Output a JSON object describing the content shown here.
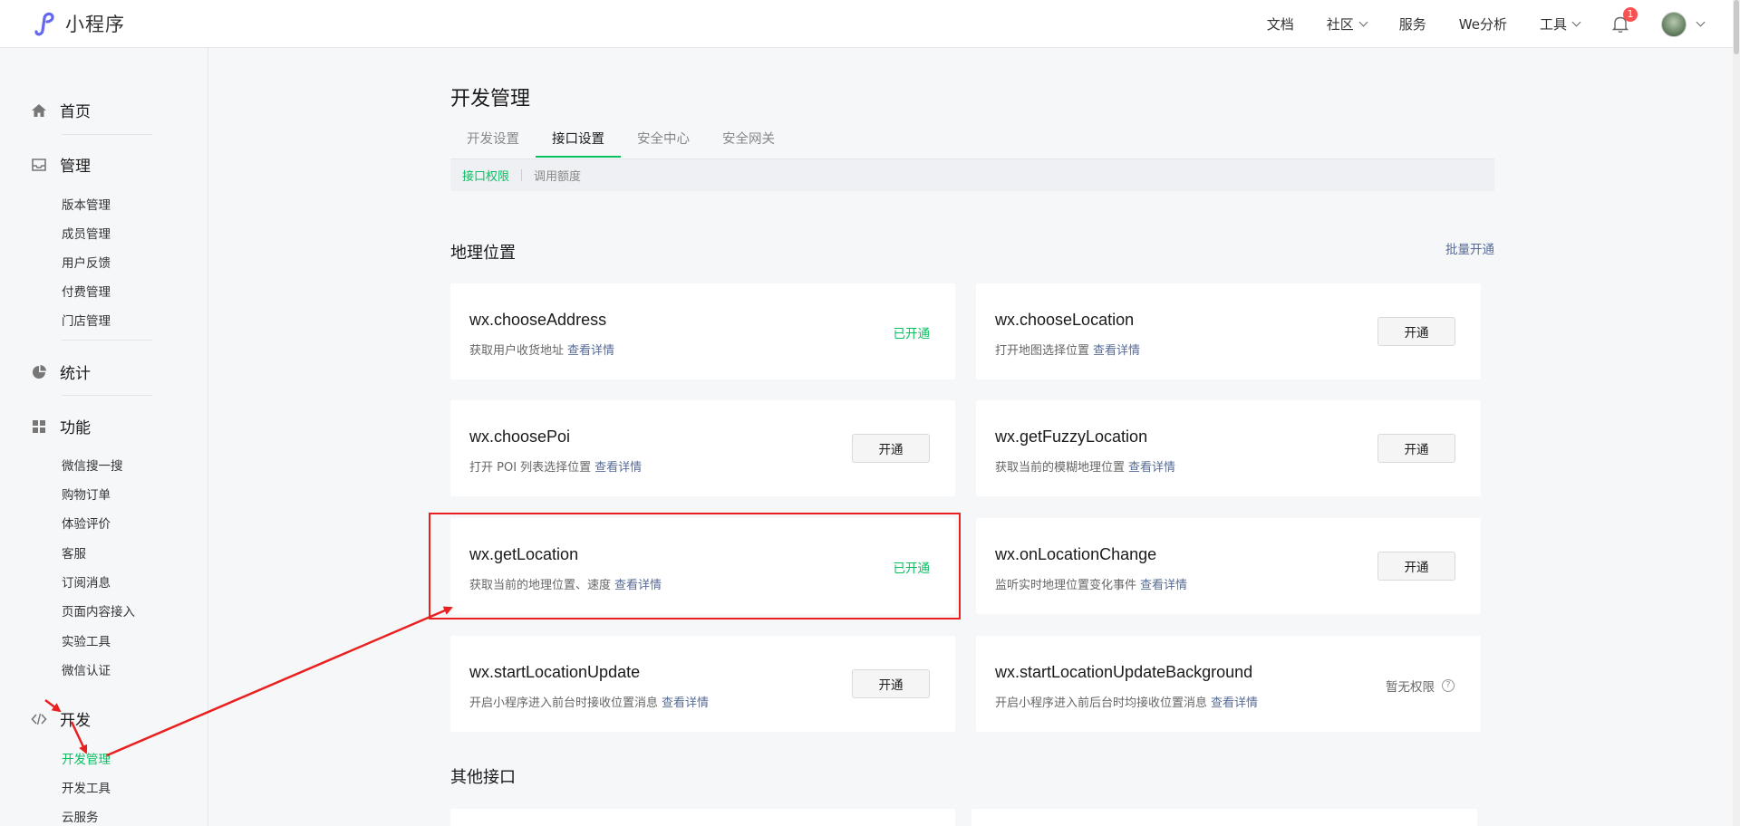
{
  "app": {
    "name": "小程序"
  },
  "topnav": {
    "items": [
      {
        "label": "文档",
        "has_caret": false
      },
      {
        "label": "社区",
        "has_caret": true
      },
      {
        "label": "服务",
        "has_caret": false
      },
      {
        "label": "We分析",
        "has_caret": false
      },
      {
        "label": "工具",
        "has_caret": true
      }
    ],
    "notification_count": "1"
  },
  "sidebar": {
    "home": "首页",
    "manage": {
      "label": "管理",
      "items": [
        "版本管理",
        "成员管理",
        "用户反馈",
        "付费管理",
        "门店管理"
      ]
    },
    "stats": "统计",
    "features": {
      "label": "功能",
      "items": [
        "微信搜一搜",
        "购物订单",
        "体验评价",
        "客服",
        "订阅消息",
        "页面内容接入",
        "实验工具",
        "微信认证"
      ]
    },
    "dev": {
      "label": "开发",
      "items": [
        "开发管理",
        "开发工具",
        "云服务"
      ],
      "active": "开发管理"
    }
  },
  "main": {
    "title": "开发管理",
    "tabs": [
      "开发设置",
      "接口设置",
      "安全中心",
      "安全网关"
    ],
    "active_tab": "接口设置",
    "subtabs": [
      "接口权限",
      "调用额度"
    ],
    "active_subtab": "接口权限",
    "sections": {
      "geo_title": "地理位置",
      "batch_open": "批量开通",
      "other_title": "其他接口"
    },
    "more_label": "查看详情",
    "status_on": "已开通",
    "open_btn": "开通",
    "no_perm": "暂无权限",
    "cards": [
      {
        "name": "wx.chooseAddress",
        "desc": "获取用户收货地址",
        "state": "on"
      },
      {
        "name": "wx.chooseLocation",
        "desc": "打开地图选择位置",
        "state": "btn"
      },
      {
        "name": "wx.choosePoi",
        "desc": "打开 POI 列表选择位置",
        "state": "btn"
      },
      {
        "name": "wx.getFuzzyLocation",
        "desc": "获取当前的模糊地理位置",
        "state": "btn"
      },
      {
        "name": "wx.getLocation",
        "desc": "获取当前的地理位置、速度",
        "state": "on"
      },
      {
        "name": "wx.onLocationChange",
        "desc": "监听实时地理位置变化事件",
        "state": "btn"
      },
      {
        "name": "wx.startLocationUpdate",
        "desc": "开启小程序进入前台时接收位置消息",
        "state": "btn"
      },
      {
        "name": "wx.startLocationUpdateBackground",
        "desc": "开启小程序进入前后台时均接收位置消息",
        "state": "none"
      }
    ]
  },
  "colors": {
    "accent": "#07c160",
    "link": "#576b95",
    "annotation": "#e8201f"
  }
}
